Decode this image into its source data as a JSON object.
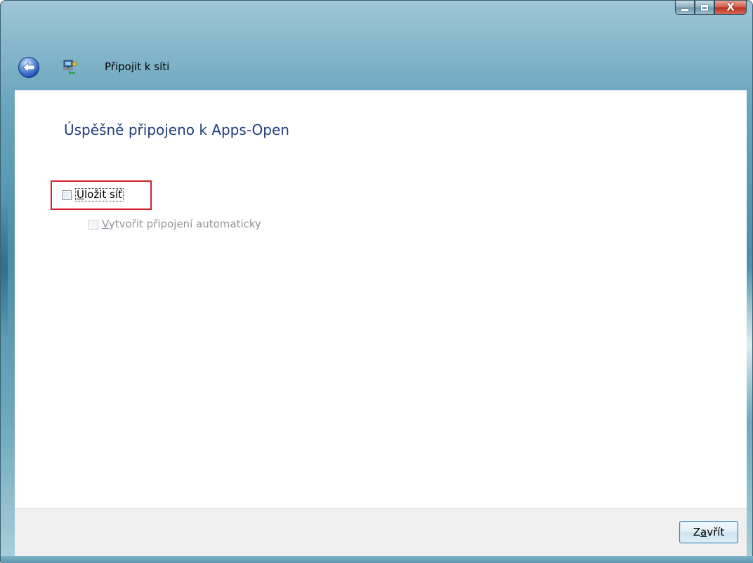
{
  "window": {
    "title": "Připojit k síti",
    "caption_buttons": {
      "minimize": "minimize-icon",
      "maximize": "maximize-icon",
      "close": "close-icon",
      "close_glyph": "X"
    }
  },
  "content": {
    "heading": "Úspěšně připojeno k Apps-Open",
    "save_network": {
      "label_mnemonic": "U",
      "label_rest": "ložit síť",
      "checked": false
    },
    "auto_connect": {
      "label_mnemonic": "V",
      "label_rest": "ytvořit připojení automaticky",
      "checked": false,
      "enabled": false
    }
  },
  "footer": {
    "close_button_pre": "Z",
    "close_button_mnemonic": "a",
    "close_button_post": "vřít"
  },
  "colors": {
    "heading": "#1e3c7a",
    "highlight": "#d4202a",
    "disabled_text": "#8e959c"
  },
  "icons": {
    "back": "back-arrow-icon",
    "network": "network-connection-icon"
  }
}
